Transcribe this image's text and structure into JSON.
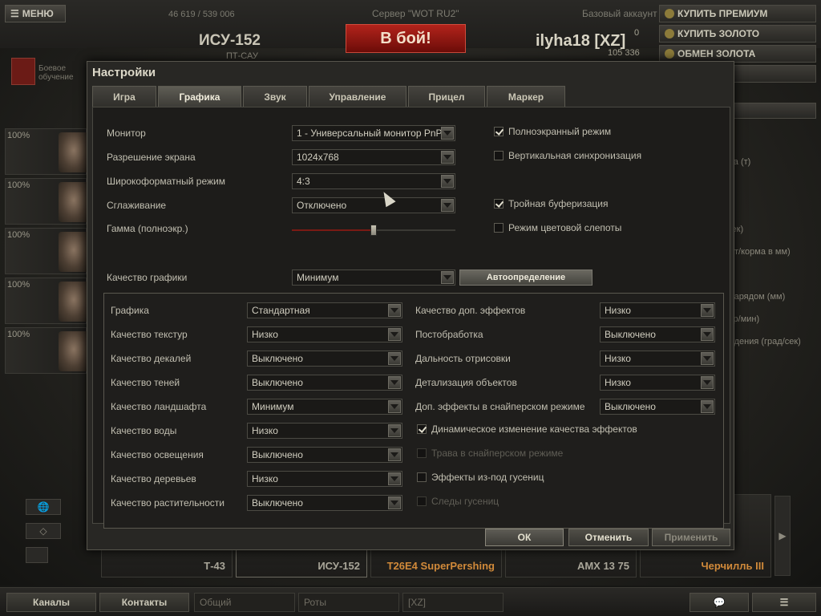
{
  "topbar": {
    "menu_label": "МЕНЮ",
    "experience": "46 619 / 539 006",
    "server": "Сервер \"WOT RU2\"",
    "tank_name": "ИСУ-152",
    "tank_type": "ПТ-САУ",
    "battle_label": "В бой!",
    "player": "ilyha18 [XZ]",
    "gold": "0",
    "credits": "105 336",
    "account": "Базовый аккаунт",
    "buy_premium": "КУПИТЬ ПРЕМИУМ",
    "buy_gold": "КУПИТЬ ЗОЛОТО",
    "exchange_gold": "ОБМЕН ЗОЛОТА",
    "training_label": "Боевое обучение"
  },
  "crew": [
    {
      "pct": "100%"
    },
    {
      "pct": "100%"
    },
    {
      "pct": "100%"
    },
    {
      "pct": "100%"
    },
    {
      "pct": "100%"
    }
  ],
  "right_info": [
    "ота (т)",
    "/сек)",
    "орт/корма в мм)",
    "снарядом (мм)",
    "стр/мин)",
    "ведения (град/сек)"
  ],
  "carousel": [
    {
      "name": "Т-43",
      "premium": false
    },
    {
      "name": "ИСУ-152",
      "premium": false
    },
    {
      "name": "T26E4 SuperPershing",
      "premium": true
    },
    {
      "name": "AMX 13 75",
      "premium": false
    },
    {
      "name": "Черчилль III",
      "premium": true
    }
  ],
  "bottombar": {
    "channels": "Каналы",
    "contacts": "Контакты",
    "common": "Общий",
    "companies": "Роты",
    "clan": "[XZ]"
  },
  "dialog": {
    "title": "Настройки",
    "tabs": [
      {
        "label": "Игра",
        "active": false
      },
      {
        "label": "Графика",
        "active": true
      },
      {
        "label": "Звук",
        "active": false
      },
      {
        "label": "Управление",
        "active": false
      },
      {
        "label": "Прицел",
        "active": false
      },
      {
        "label": "Маркер",
        "active": false
      }
    ],
    "main": {
      "monitor_label": "Монитор",
      "monitor_value": "1 - Универсальный монитор PnP",
      "resolution_label": "Разрешение экрана",
      "resolution_value": "1024x768",
      "widescreen_label": "Широкоформатный режим",
      "widescreen_value": "4:3",
      "aa_label": "Сглаживание",
      "aa_value": "Отключено",
      "gamma_label": "Гамма (полноэкр.)",
      "gamma_value": 0.5,
      "fullscreen_label": "Полноэкранный режим",
      "fullscreen_on": true,
      "vsync_label": "Вертикальная синхронизация",
      "vsync_on": false,
      "triple_label": "Тройная буферизация",
      "triple_on": true,
      "colorblind_label": "Режим цветовой слепоты",
      "colorblind_on": false,
      "quality_label": "Качество графики",
      "quality_value": "Минимум",
      "auto_label": "Автоопределение"
    },
    "advanced_left": [
      {
        "label": "Графика",
        "value": "Стандартная"
      },
      {
        "label": "Качество текстур",
        "value": "Низко"
      },
      {
        "label": "Качество декалей",
        "value": "Выключено"
      },
      {
        "label": "Качество теней",
        "value": "Выключено"
      },
      {
        "label": "Качество ландшафта",
        "value": "Минимум"
      },
      {
        "label": "Качество воды",
        "value": "Низко"
      },
      {
        "label": "Качество освещения",
        "value": "Выключено"
      },
      {
        "label": "Качество деревьев",
        "value": "Низко"
      },
      {
        "label": "Качество растительности",
        "value": "Выключено"
      }
    ],
    "advanced_right": [
      {
        "label": "Качество доп. эффектов",
        "value": "Низко"
      },
      {
        "label": "Постобработка",
        "value": "Выключено"
      },
      {
        "label": "Дальность отрисовки",
        "value": "Низко"
      },
      {
        "label": "Детализация объектов",
        "value": "Низко"
      },
      {
        "label": "Доп. эффекты в снайперском режиме",
        "value": "Выключено"
      }
    ],
    "advanced_checks": [
      {
        "label": "Динамическое изменение качества эффектов",
        "on": true,
        "disabled": false
      },
      {
        "label": "Трава в снайперском режиме",
        "on": false,
        "disabled": true
      },
      {
        "label": "Эффекты из-под гусениц",
        "on": false,
        "disabled": false
      },
      {
        "label": "Следы гусениц",
        "on": false,
        "disabled": true
      }
    ],
    "buttons": {
      "ok": "ОК",
      "cancel": "Отменить",
      "apply": "Применить"
    }
  },
  "colors": {
    "accent_red": "#b2231b",
    "premium_orange": "#d18a3a",
    "dialog_bg": "#282724"
  }
}
